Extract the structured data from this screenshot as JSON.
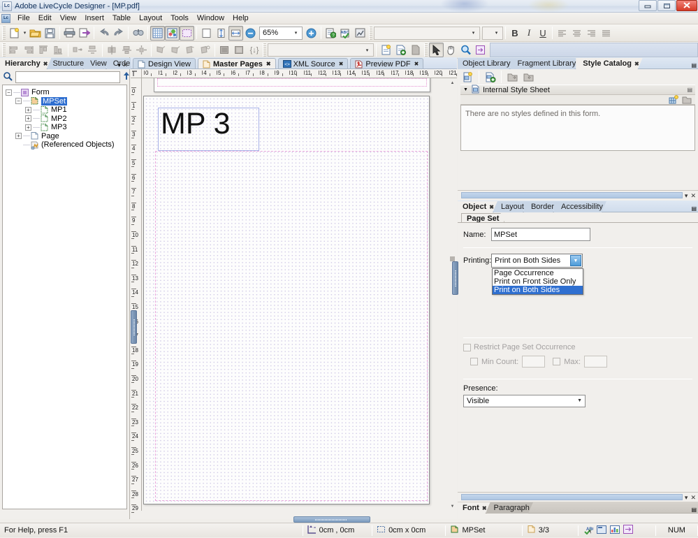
{
  "window": {
    "title": "Adobe LiveCycle Designer - [MP.pdf]",
    "app_icon": "livecycle-icon",
    "minimize_label": "—",
    "maximize_label": "❐",
    "close_label": "✕"
  },
  "menubar": {
    "items": [
      "File",
      "Edit",
      "View",
      "Insert",
      "Table",
      "Layout",
      "Tools",
      "Window",
      "Help"
    ]
  },
  "toolbar_main": {
    "zoom_value": "65%",
    "font_combo_value": "",
    "font_size_value": "",
    "bold_label": "B",
    "italic_label": "I",
    "underline_label": "U"
  },
  "toolbar_align": {
    "object_combo_value": ""
  },
  "left_panel": {
    "tabs": [
      {
        "label": "Hierarchy",
        "active": true,
        "closable": true
      },
      {
        "label": "Structure",
        "active": false,
        "closable": false
      },
      {
        "label": "View",
        "active": false,
        "closable": false
      },
      {
        "label": "Order",
        "active": false,
        "closable": false
      }
    ],
    "search": {
      "value": "",
      "placeholder": ""
    },
    "tree": [
      {
        "label": "Form",
        "depth": 0,
        "expander": "-",
        "icon": "form-icon",
        "selected": false
      },
      {
        "label": "MPSet",
        "depth": 1,
        "expander": "-",
        "icon": "pageset-icon",
        "selected": true
      },
      {
        "label": "MP1",
        "depth": 2,
        "expander": "+",
        "icon": "masterpage-icon",
        "selected": false
      },
      {
        "label": "MP2",
        "depth": 2,
        "expander": "+",
        "icon": "masterpage-icon",
        "selected": false
      },
      {
        "label": "MP3",
        "depth": 2,
        "expander": "+",
        "icon": "masterpage-icon",
        "selected": false
      },
      {
        "label": "Page",
        "depth": 1,
        "expander": "+",
        "icon": "page-icon",
        "selected": false
      },
      {
        "label": "(Referenced Objects)",
        "depth": 1,
        "expander": "",
        "icon": "referenced-icon",
        "selected": false
      }
    ]
  },
  "center": {
    "tabs": [
      {
        "label": "Design View",
        "active": false,
        "closable": false,
        "icon": "page-icon"
      },
      {
        "label": "Master Pages",
        "active": true,
        "closable": true,
        "icon": "masterpage-icon"
      },
      {
        "label": "XML Source",
        "active": false,
        "closable": true,
        "icon": "xml-icon"
      },
      {
        "label": "Preview PDF",
        "active": false,
        "closable": true,
        "icon": "pdf-icon"
      }
    ],
    "ruler_h_ticks": [
      0,
      1,
      2,
      3,
      4,
      5,
      6,
      7,
      8,
      9,
      10,
      11,
      12,
      13,
      14,
      15,
      16,
      17,
      18,
      19,
      20,
      21
    ],
    "ruler_v_ticks": [
      0,
      1,
      2,
      3,
      4,
      5,
      6,
      7,
      8,
      9,
      10,
      11,
      12,
      13,
      14,
      15,
      16,
      17,
      18,
      19,
      20,
      21,
      22,
      23,
      24,
      25,
      26,
      27,
      28,
      29
    ],
    "canvas": {
      "page_label": "MP 3"
    }
  },
  "right_panel": {
    "top_tabs": [
      {
        "label": "Object Library",
        "active": false,
        "closable": false
      },
      {
        "label": "Fragment Library",
        "active": false,
        "closable": false
      },
      {
        "label": "Style Catalog",
        "active": true,
        "closable": true
      }
    ],
    "style_catalog": {
      "group_header": "Internal Style Sheet",
      "empty_message": "There are no styles defined in this form.",
      "toolbar_icons": [
        "new-style-sheet-icon",
        "add-style-icon",
        "import-style-icon",
        "export-style-icon"
      ],
      "inner_icons": [
        "new-style-icon",
        "delete-style-icon"
      ]
    },
    "object_tabs": [
      {
        "label": "Object",
        "active": true,
        "closable": true
      },
      {
        "label": "Layout",
        "active": false,
        "closable": false
      },
      {
        "label": "Border",
        "active": false,
        "closable": false
      },
      {
        "label": "Accessibility",
        "active": false,
        "closable": false
      }
    ],
    "object_subtabs": [
      {
        "label": "Page Set",
        "active": true
      }
    ],
    "object_form": {
      "name_label": "Name:",
      "name_value": "MPSet",
      "printing_label": "Printing:",
      "printing_value": "Print on Both Sides",
      "printing_options": [
        {
          "label": "Page Occurrence",
          "selected": false
        },
        {
          "label": "Print on Front Side Only",
          "selected": false
        },
        {
          "label": "Print on Both Sides",
          "selected": true
        }
      ],
      "restrict_label": "Restrict Page Set Occurrence",
      "restrict_checked": false,
      "min_count_label": "Min Count:",
      "min_count_checked": false,
      "min_count_value": "",
      "max_label": "Max:",
      "max_checked": false,
      "max_value": "",
      "presence_label": "Presence:",
      "presence_value": "Visible"
    },
    "font_tabs": [
      {
        "label": "Font",
        "active": true,
        "closable": true
      },
      {
        "label": "Paragraph",
        "active": false,
        "closable": false
      }
    ]
  },
  "statusbar": {
    "help_text": "For Help, press F1",
    "coords": "0cm , 0cm",
    "size": "0cm x 0cm",
    "selection": "MPSet",
    "pages": "3/3",
    "num_indicator": "NUM",
    "icons": [
      "spellcheck-icon",
      "preview-icon",
      "chart-icon",
      "form-icon"
    ]
  },
  "colors": {
    "accent_blue": "#2f6fd0",
    "panel_bg": "#f1efec",
    "title_text": "#11315c",
    "grid_dot": "#cfc8e6",
    "content_dash": "#e9a6dc",
    "textbox_border": "#a7b1e8"
  }
}
